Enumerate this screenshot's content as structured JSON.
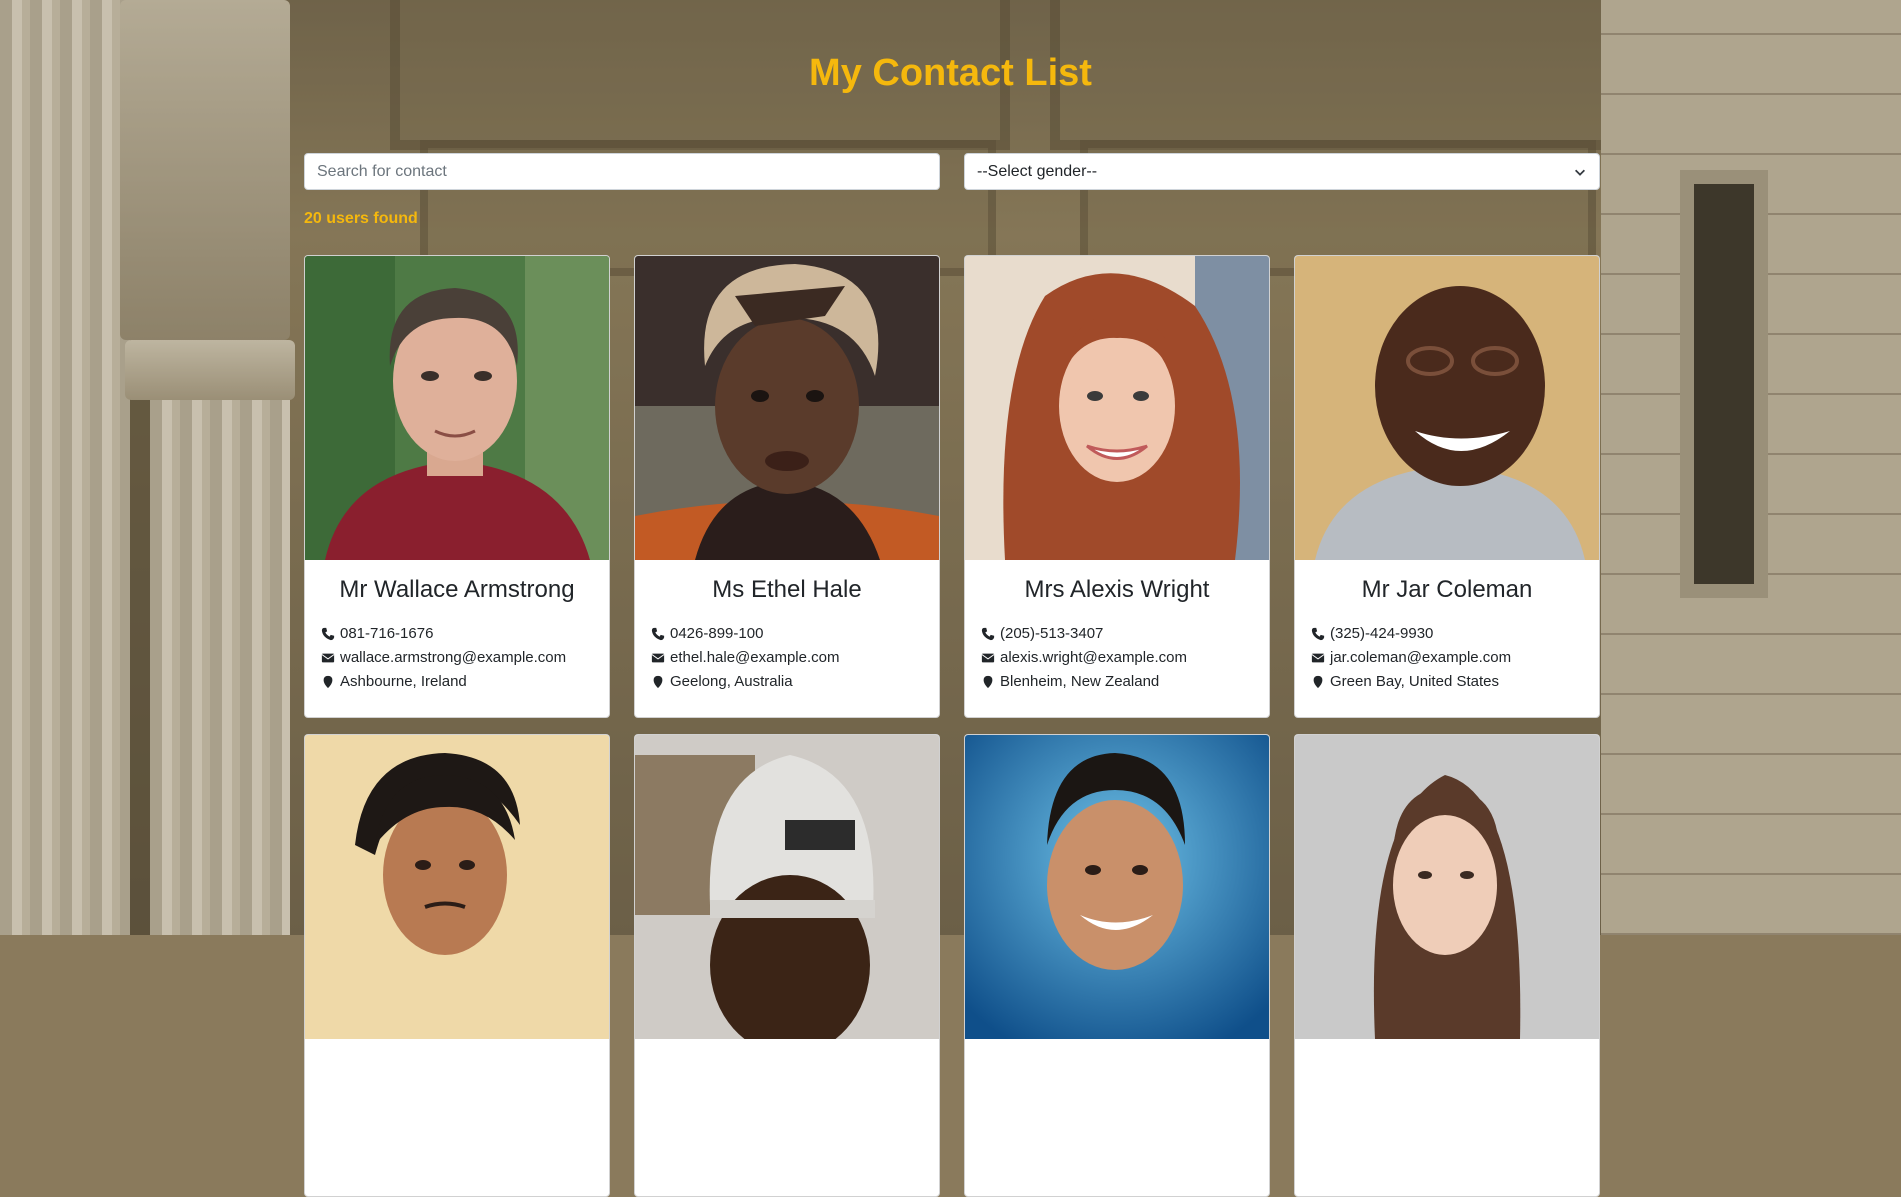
{
  "header": {
    "title": "My Contact List"
  },
  "filters": {
    "search_placeholder": "Search for contact",
    "gender_selected": "--Select gender--"
  },
  "results": {
    "count_text": "20 users found"
  },
  "colors": {
    "accent": "#f5b80d",
    "card_bg": "#ffffff",
    "text": "#212529"
  },
  "contacts": [
    {
      "name": "Mr Wallace Armstrong",
      "phone": "081-716-1676",
      "email": "wallace.armstrong@example.com",
      "location": "Ashbourne, Ireland"
    },
    {
      "name": "Ms Ethel Hale",
      "phone": "0426-899-100",
      "email": "ethel.hale@example.com",
      "location": "Geelong, Australia"
    },
    {
      "name": "Mrs Alexis Wright",
      "phone": "(205)-513-3407",
      "email": "alexis.wright@example.com",
      "location": "Blenheim, New Zealand"
    },
    {
      "name": "Mr Jar Coleman",
      "phone": "(325)-424-9930",
      "email": "jar.coleman@example.com",
      "location": "Green Bay, United States"
    },
    {
      "name": "",
      "phone": "",
      "email": "",
      "location": ""
    },
    {
      "name": "",
      "phone": "",
      "email": "",
      "location": ""
    },
    {
      "name": "",
      "phone": "",
      "email": "",
      "location": ""
    },
    {
      "name": "",
      "phone": "",
      "email": "",
      "location": ""
    }
  ],
  "icons": {
    "phone": "phone-icon",
    "email": "envelope-icon",
    "location": "map-marker-icon",
    "dropdown": "chevron-down-icon"
  }
}
